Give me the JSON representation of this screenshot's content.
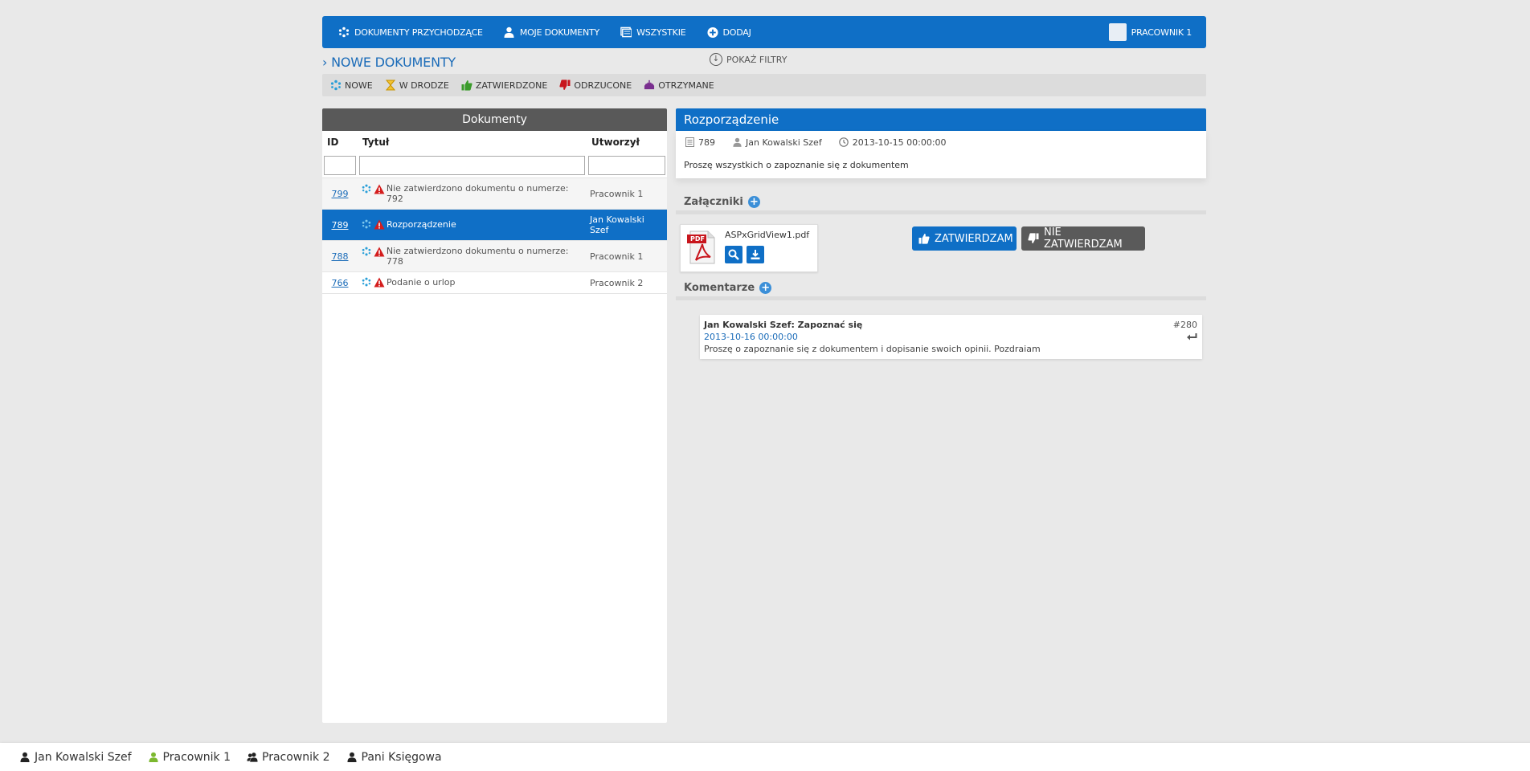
{
  "nav": {
    "items": [
      {
        "label": "DOKUMENTY PRZYCHODZĄCE",
        "icon": "incoming-icon"
      },
      {
        "label": "MOJE DOKUMENTY",
        "icon": "user-icon"
      },
      {
        "label": "WSZYSTKIE",
        "icon": "documents-icon"
      },
      {
        "label": "DODAJ",
        "icon": "plus-circle-icon"
      }
    ],
    "user": "PRACOWNIK 1"
  },
  "section_title": "› NOWE DOKUMENTY",
  "filters_label": "POKAŻ FILTRY",
  "statuses": [
    {
      "label": "NOWE",
      "icon": "new-icon",
      "color": "#2a9fd8"
    },
    {
      "label": "W DRODZE",
      "icon": "hourglass-icon",
      "color": "#e0a800"
    },
    {
      "label": "ZATWIERDZONE",
      "icon": "thumbs-up-icon",
      "color": "#3a9b2a"
    },
    {
      "label": "ODRZUCONE",
      "icon": "thumbs-down-icon",
      "color": "#c8161d"
    },
    {
      "label": "OTRZYMANE",
      "icon": "inbox-icon",
      "color": "#7a2f8f"
    }
  ],
  "list": {
    "title": "Dokumenty",
    "headers": {
      "id": "ID",
      "title": "Tytuł",
      "created": "Utworzył"
    },
    "rows": [
      {
        "id": "799",
        "title": "Nie zatwierdzono dokumentu o numerze: 792",
        "created": "Pracownik 1"
      },
      {
        "id": "789",
        "title": "Rozporządzenie",
        "created": "Jan Kowalski Szef"
      },
      {
        "id": "788",
        "title": "Nie zatwierdzono dokumentu o numerze: 778",
        "created": "Pracownik 1"
      },
      {
        "id": "766",
        "title": "Podanie o urlop",
        "created": "Pracownik 2"
      }
    ]
  },
  "doc": {
    "title": "Rozporządzenie",
    "id": "789",
    "author": "Jan Kowalski Szef",
    "date": "2013-10-15 00:00:00",
    "body": "Proszę wszystkich o zapoznanie się z dokumentem"
  },
  "attachments": {
    "title": "Załączniki",
    "file": "ASPxGridView1.pdf",
    "pdf_badge": "PDF"
  },
  "buttons": {
    "approve": "ZATWIERDZAM",
    "reject": "NIE ZATWIERDZAM"
  },
  "comments": {
    "title": "Komentarze",
    "items": [
      {
        "author": "Jan Kowalski Szef:  Zapoznać się",
        "date": "2013-10-16 00:00:00",
        "body": "Proszę o zapoznanie się z dokumentem i dopisanie swoich opinii. Pozdraiam",
        "number": "#280"
      }
    ]
  },
  "footer": {
    "users": [
      {
        "label": "Jan Kowalski Szef",
        "color": "#222222"
      },
      {
        "label": "Pracownik 1",
        "color": "#7cb82f"
      },
      {
        "label": "Pracownik 2",
        "color": "#222222"
      },
      {
        "label": "Pani Księgowa",
        "color": "#222222"
      }
    ]
  }
}
